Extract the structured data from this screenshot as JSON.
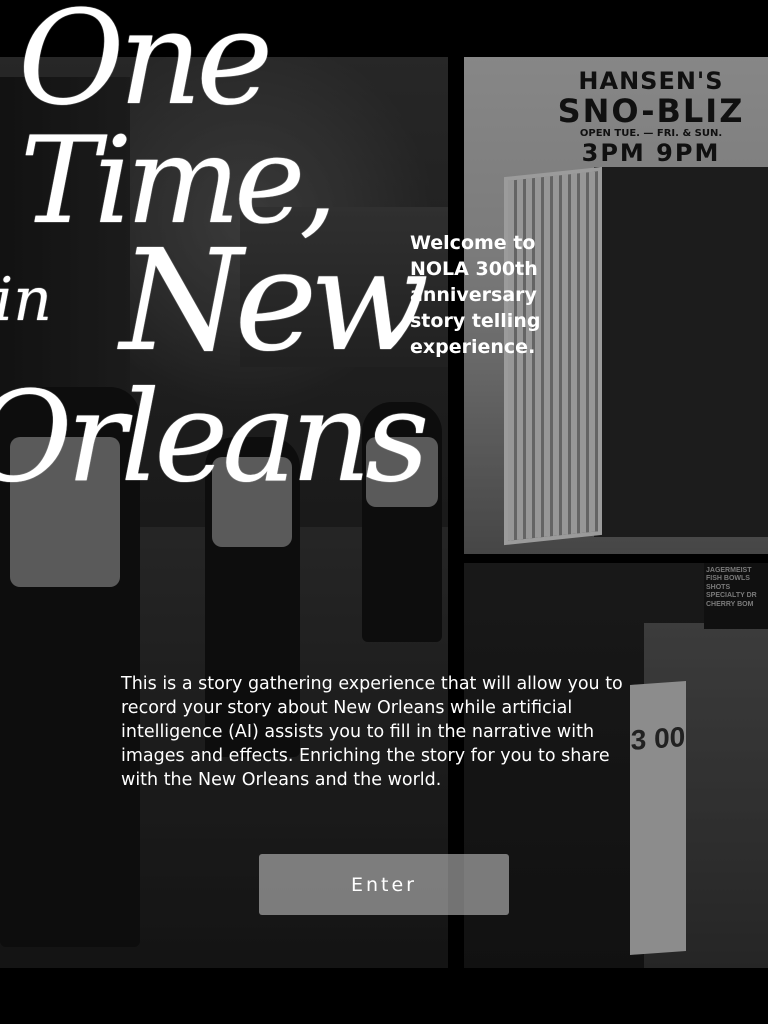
{
  "hero": {
    "title_lines": [
      "One",
      "Time,",
      "in",
      "New",
      "Orleans"
    ],
    "welcome_text": "Welcome to\nNOLA 300th anniversary\nstory telling experience."
  },
  "photos": {
    "right_top_sign": {
      "line1": "HANSEN'S",
      "line2": "SNO-BLIZ",
      "line3": "OPEN TUE. — FRI. & SUN.",
      "line4": "3PM  9PM"
    },
    "right_bottom_menu": "JAGERMEIST\nFISH BOWLS\nSHOTS\nSPECIALTY DR\nCHERRY BOM",
    "right_bottom_board": "3 00"
  },
  "intro": {
    "description": "This is a story gathering experience that will allow you to record your story about New Orleans while artificial intelligence (AI) assists you to fill in the narrative with images and effects. Enriching the story for you to share with the New Orleans and the world."
  },
  "actions": {
    "enter_label": "Enter"
  }
}
